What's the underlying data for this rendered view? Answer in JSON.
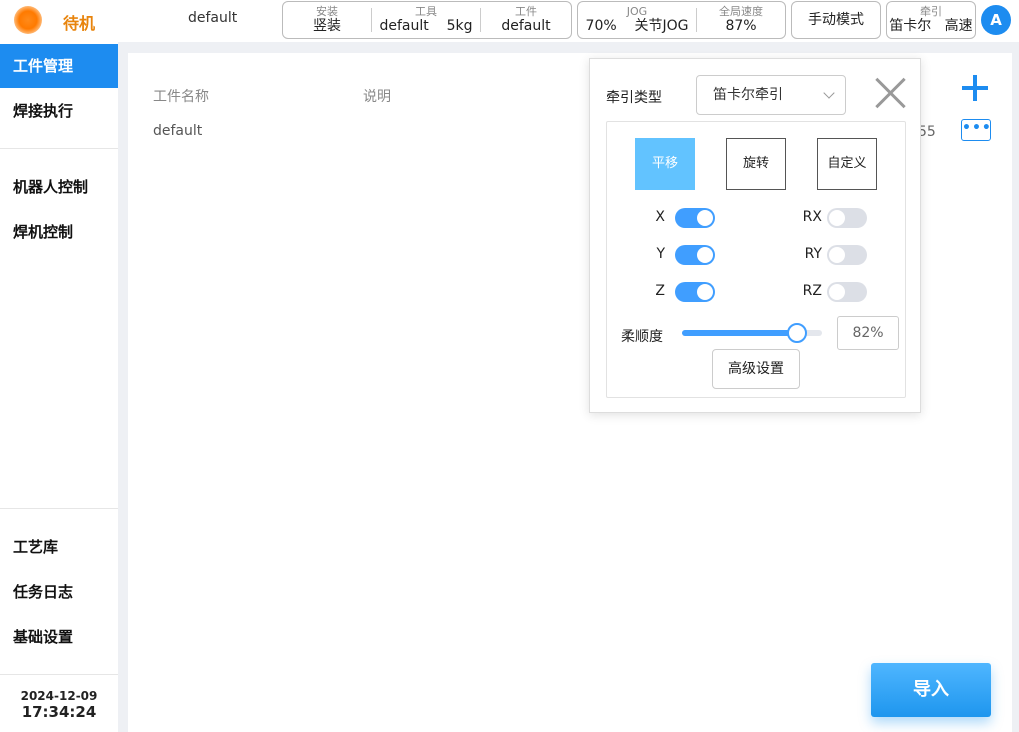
{
  "header": {
    "status": "待机",
    "project": "default",
    "install": {
      "label": "安装",
      "value": "竖装"
    },
    "tool": {
      "label": "工具",
      "value": "default",
      "weight": "5kg"
    },
    "workpiece": {
      "label": "工件",
      "value": "default"
    },
    "jog": {
      "label": "JOG",
      "percent": "70%",
      "mode": "关节JOG"
    },
    "global_speed": {
      "label": "全局速度",
      "value": "87%"
    },
    "mode_button": "手动模式",
    "traction": {
      "label": "牵引",
      "type": "笛卡尔",
      "speed": "高速"
    },
    "avatar": "A"
  },
  "sidebar": {
    "items": [
      "工件管理",
      "焊接执行",
      "机器人控制",
      "焊机控制",
      "工艺库",
      "任务日志",
      "基础设置"
    ],
    "active": "工件管理",
    "date": "2024-12-09",
    "time": "17:34:24"
  },
  "main": {
    "columns": [
      "工件名称",
      "说明"
    ],
    "rows": [
      {
        "name": "default",
        "desc": ""
      }
    ],
    "partial_text": "55",
    "import_button": "导入"
  },
  "popup": {
    "traction_type_label": "牵引类型",
    "traction_type_value": "笛卡尔牵引",
    "modes": [
      "平移",
      "旋转",
      "自定义"
    ],
    "active_mode": "平移",
    "axes": [
      {
        "name": "X",
        "on": true
      },
      {
        "name": "Y",
        "on": true
      },
      {
        "name": "Z",
        "on": true
      },
      {
        "name": "RX",
        "on": false
      },
      {
        "name": "RY",
        "on": false
      },
      {
        "name": "RZ",
        "on": false
      }
    ],
    "compliance_label": "柔顺度",
    "compliance_value": 82,
    "compliance_text": "82%",
    "advanced_button": "高级设置"
  },
  "colors": {
    "accent": "#1d8cf0",
    "status": "#e8840c",
    "toggle_on": "#409eff",
    "mode_active": "#62c3ff"
  }
}
